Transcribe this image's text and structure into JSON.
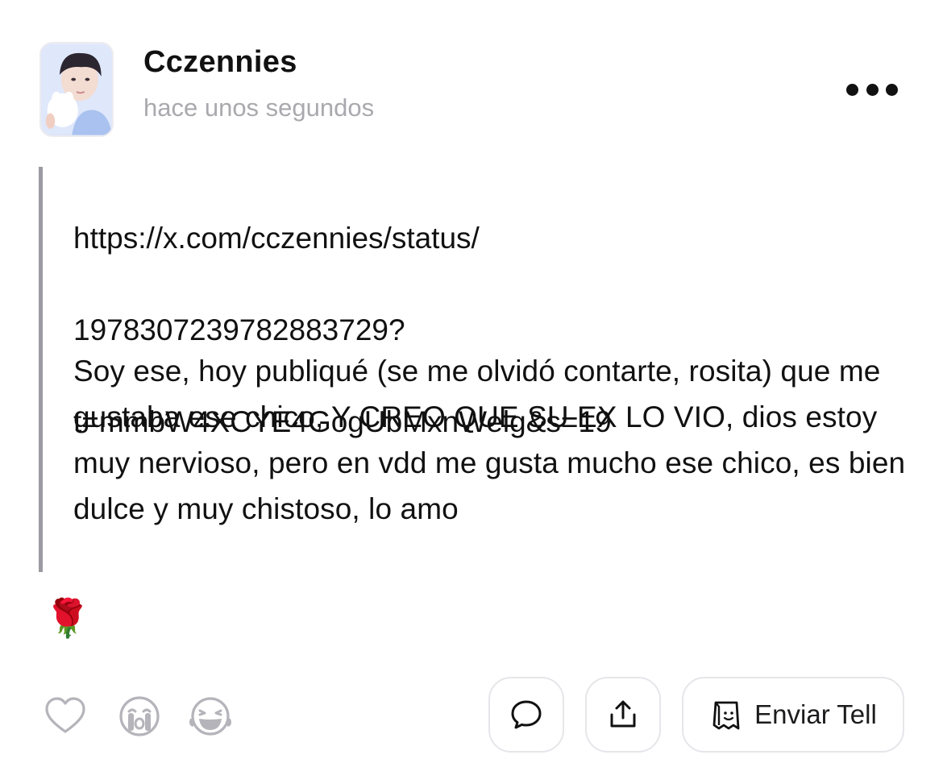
{
  "post": {
    "author": {
      "name": "Cczennies",
      "avatar_icon": "profile-photo"
    },
    "time": "hace unos segundos",
    "more_icon": "more-horizontal-icon",
    "quote_lines": [
      "https://x.com/cczennies/status/",
      "1978307239782883729?",
      "t=mmbW4XCYE4GogUbMxnWelg&s=19"
    ],
    "body": "Soy ese, hoy publiqué (se me olvidó contarte, rosita) que me gustaba ese chico, Y CREO QUE SU EX LO VIO, dios estoy muy nervioso, pero en vdd me gusta mucho ese chico, es bien dulce y muy chistoso, lo amo",
    "emoji": "🌹"
  },
  "reactions": [
    {
      "icon": "heart-icon"
    },
    {
      "icon": "crying-face-icon"
    },
    {
      "icon": "laughing-face-icon"
    }
  ],
  "actions": {
    "comment_icon": "comment-bubble-icon",
    "share_icon": "share-icon",
    "tell_icon": "tell-bag-icon",
    "tell_label": "Enviar Tell"
  },
  "colors": {
    "text": "#111111",
    "muted": "#a9a9ae",
    "quote_bar": "#9b9ba1",
    "border": "#e6e6ea"
  }
}
